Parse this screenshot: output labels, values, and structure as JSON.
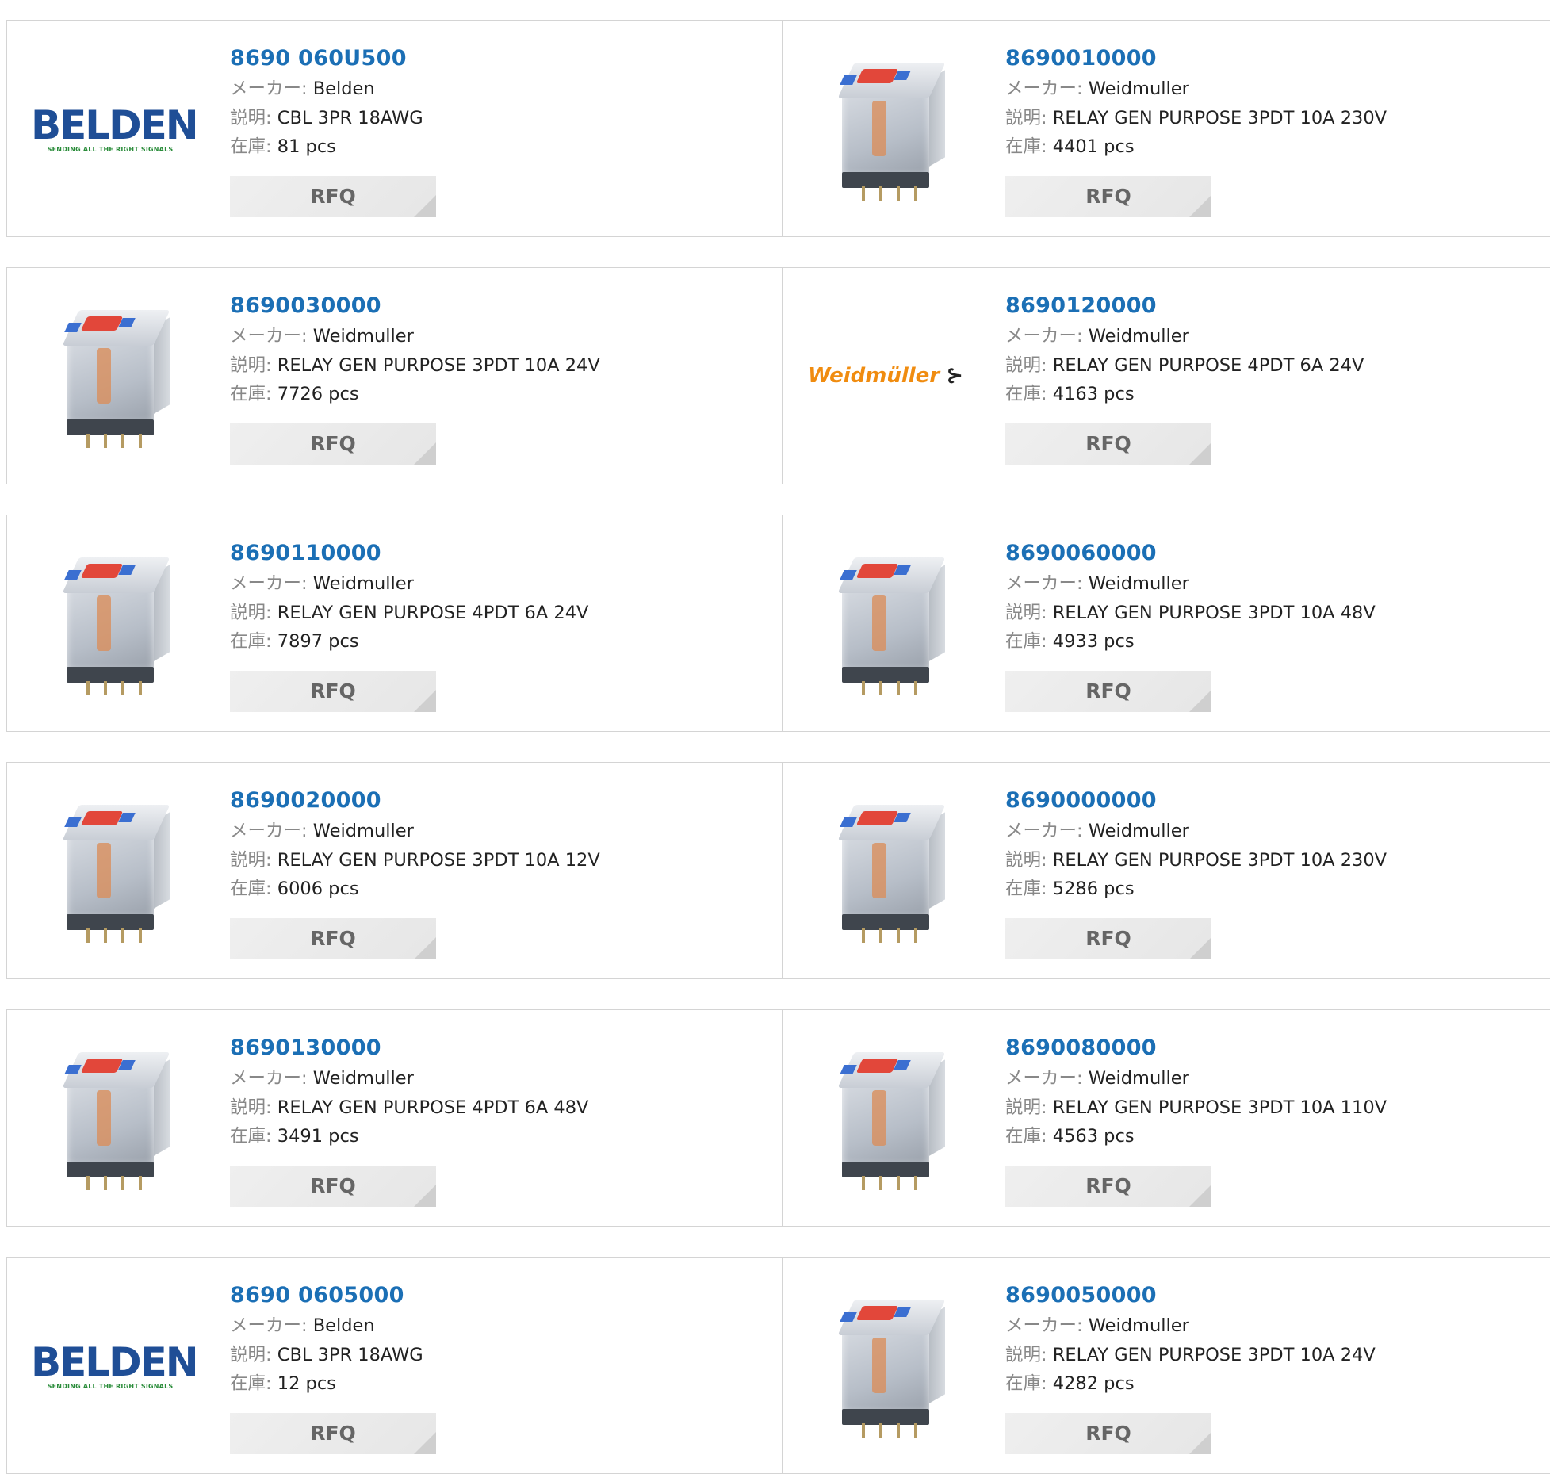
{
  "labels": {
    "maker": "メーカー:",
    "desc": "説明:",
    "stock": "在庫:",
    "rfq": "RFQ"
  },
  "logos": {
    "belden_word": "BELDEN",
    "belden_tag": "SENDING ALL THE RIGHT SIGNALS",
    "weid_word": "Weidmüller",
    "weid_sym": "⊱"
  },
  "products": [
    {
      "pn": "8690 060U500",
      "maker": "Belden",
      "desc": "CBL 3PR 18AWG",
      "stock": "81 pcs",
      "image": "belden-logo"
    },
    {
      "pn": "8690010000",
      "maker": "Weidmuller",
      "desc": "RELAY GEN PURPOSE 3PDT 10A 230V",
      "stock": "4401 pcs",
      "image": "relay-photo"
    },
    {
      "pn": "8690030000",
      "maker": "Weidmuller",
      "desc": "RELAY GEN PURPOSE 3PDT 10A 24V",
      "stock": "7726 pcs",
      "image": "relay-photo"
    },
    {
      "pn": "8690120000",
      "maker": "Weidmuller",
      "desc": "RELAY GEN PURPOSE 4PDT 6A 24V",
      "stock": "4163 pcs",
      "image": "weidmuller-logo"
    },
    {
      "pn": "8690110000",
      "maker": "Weidmuller",
      "desc": "RELAY GEN PURPOSE 4PDT 6A 24V",
      "stock": "7897 pcs",
      "image": "relay-photo"
    },
    {
      "pn": "8690060000",
      "maker": "Weidmuller",
      "desc": "RELAY GEN PURPOSE 3PDT 10A 48V",
      "stock": "4933 pcs",
      "image": "relay-photo"
    },
    {
      "pn": "8690020000",
      "maker": "Weidmuller",
      "desc": "RELAY GEN PURPOSE 3PDT 10A 12V",
      "stock": "6006 pcs",
      "image": "relay-photo"
    },
    {
      "pn": "8690000000",
      "maker": "Weidmuller",
      "desc": "RELAY GEN PURPOSE 3PDT 10A 230V",
      "stock": "5286 pcs",
      "image": "relay-photo"
    },
    {
      "pn": "8690130000",
      "maker": "Weidmuller",
      "desc": "RELAY GEN PURPOSE 4PDT 6A 48V",
      "stock": "3491 pcs",
      "image": "relay-photo"
    },
    {
      "pn": "8690080000",
      "maker": "Weidmuller",
      "desc": "RELAY GEN PURPOSE 3PDT 10A 110V",
      "stock": "4563 pcs",
      "image": "relay-photo"
    },
    {
      "pn": "8690 0605000",
      "maker": "Belden",
      "desc": "CBL 3PR 18AWG",
      "stock": "12 pcs",
      "image": "belden-logo"
    },
    {
      "pn": "8690050000",
      "maker": "Weidmuller",
      "desc": "RELAY GEN PURPOSE 3PDT 10A 24V",
      "stock": "4282 pcs",
      "image": "relay-photo"
    }
  ]
}
